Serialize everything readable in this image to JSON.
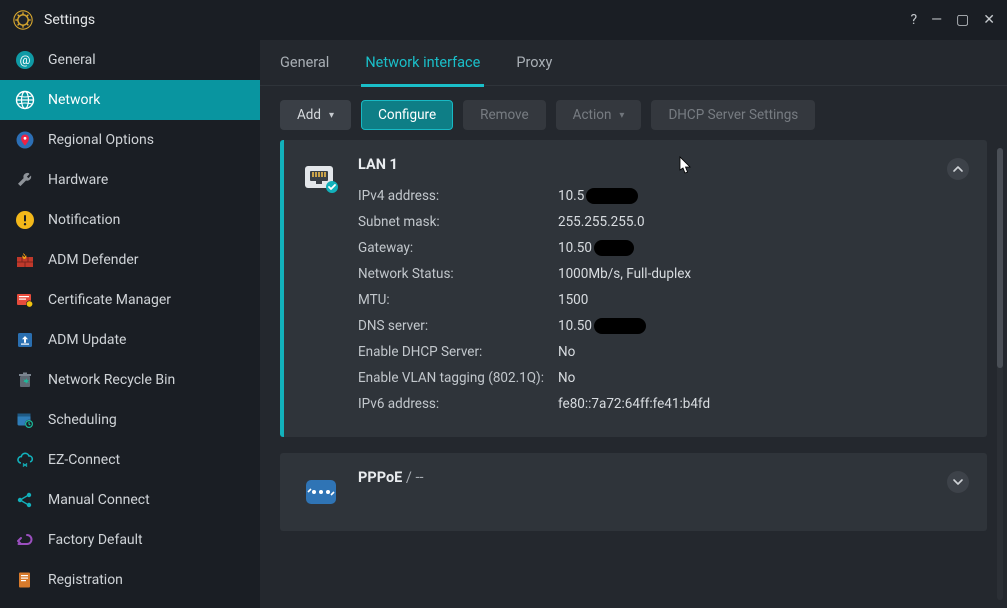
{
  "title": "Settings",
  "sidebar": {
    "items": [
      {
        "label": "General"
      },
      {
        "label": "Network"
      },
      {
        "label": "Regional Options"
      },
      {
        "label": "Hardware"
      },
      {
        "label": "Notification"
      },
      {
        "label": "ADM Defender"
      },
      {
        "label": "Certificate Manager"
      },
      {
        "label": "ADM Update"
      },
      {
        "label": "Network Recycle Bin"
      },
      {
        "label": "Scheduling"
      },
      {
        "label": "EZ-Connect"
      },
      {
        "label": "Manual Connect"
      },
      {
        "label": "Factory Default"
      },
      {
        "label": "Registration"
      }
    ],
    "active_index": 1
  },
  "tabs": {
    "items": [
      {
        "label": "General"
      },
      {
        "label": "Network interface"
      },
      {
        "label": "Proxy"
      }
    ],
    "active_index": 1
  },
  "toolbar": {
    "add": "Add",
    "configure": "Configure",
    "remove": "Remove",
    "action": "Action",
    "dhcp": "DHCP Server Settings"
  },
  "interfaces": [
    {
      "title": "LAN 1",
      "selected": true,
      "rows": [
        {
          "k": "IPv4 address:",
          "v_prefix": "10.5",
          "redact": true
        },
        {
          "k": "Subnet mask:",
          "v": "255.255.255.0"
        },
        {
          "k": "Gateway:",
          "v_prefix": "10.50",
          "redact": "sm"
        },
        {
          "k": "Network Status:",
          "v": "1000Mb/s, Full-duplex"
        },
        {
          "k": "MTU:",
          "v": "1500"
        },
        {
          "k": "DNS server:",
          "v_prefix": "10.50",
          "redact": true
        },
        {
          "k": "Enable DHCP Server:",
          "v": "No"
        },
        {
          "k": "Enable VLAN tagging (802.1Q):",
          "v": "No"
        },
        {
          "k": "IPv6 address:",
          "v": "fe80::7a72:64ff:fe41:b4fd"
        }
      ]
    },
    {
      "title": "PPPoE",
      "subtitle": "/ --",
      "selected": false,
      "rows": []
    }
  ]
}
